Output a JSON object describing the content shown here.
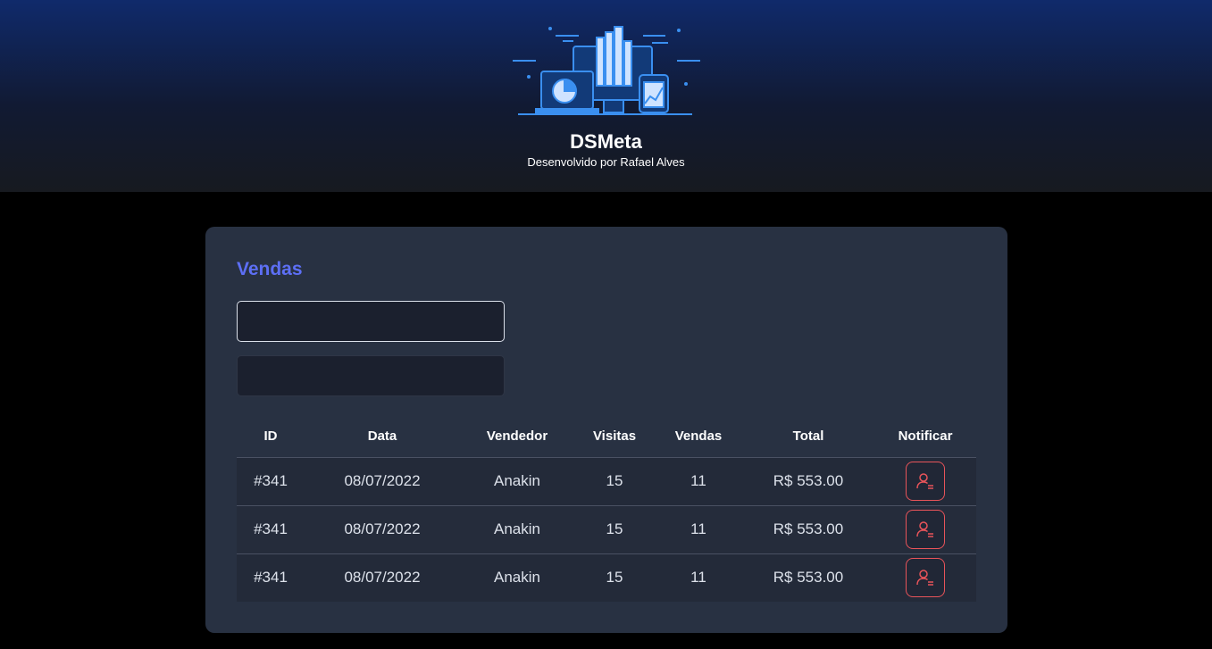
{
  "header": {
    "title": "DSMeta",
    "subtitle": "Desenvolvido por Rafael Alves",
    "logo_icon": "dashboard-devices-illustration"
  },
  "sales": {
    "title": "Vendas",
    "min_date": "",
    "max_date": "",
    "columns": [
      "ID",
      "Data",
      "Vendedor",
      "Visitas",
      "Vendas",
      "Total",
      "Notificar"
    ],
    "rows": [
      {
        "id": "#341",
        "date": "08/07/2022",
        "seller": "Anakin",
        "visits": "15",
        "deals": "11",
        "total": "R$ 553.00"
      },
      {
        "id": "#341",
        "date": "08/07/2022",
        "seller": "Anakin",
        "visits": "15",
        "deals": "11",
        "total": "R$ 553.00"
      },
      {
        "id": "#341",
        "date": "08/07/2022",
        "seller": "Anakin",
        "visits": "15",
        "deals": "11",
        "total": "R$ 553.00"
      }
    ],
    "notify_icon": "user-notify-icon"
  },
  "colors": {
    "accent": "#5d6ff5",
    "card": "#283142",
    "notify": "#e8545a"
  }
}
